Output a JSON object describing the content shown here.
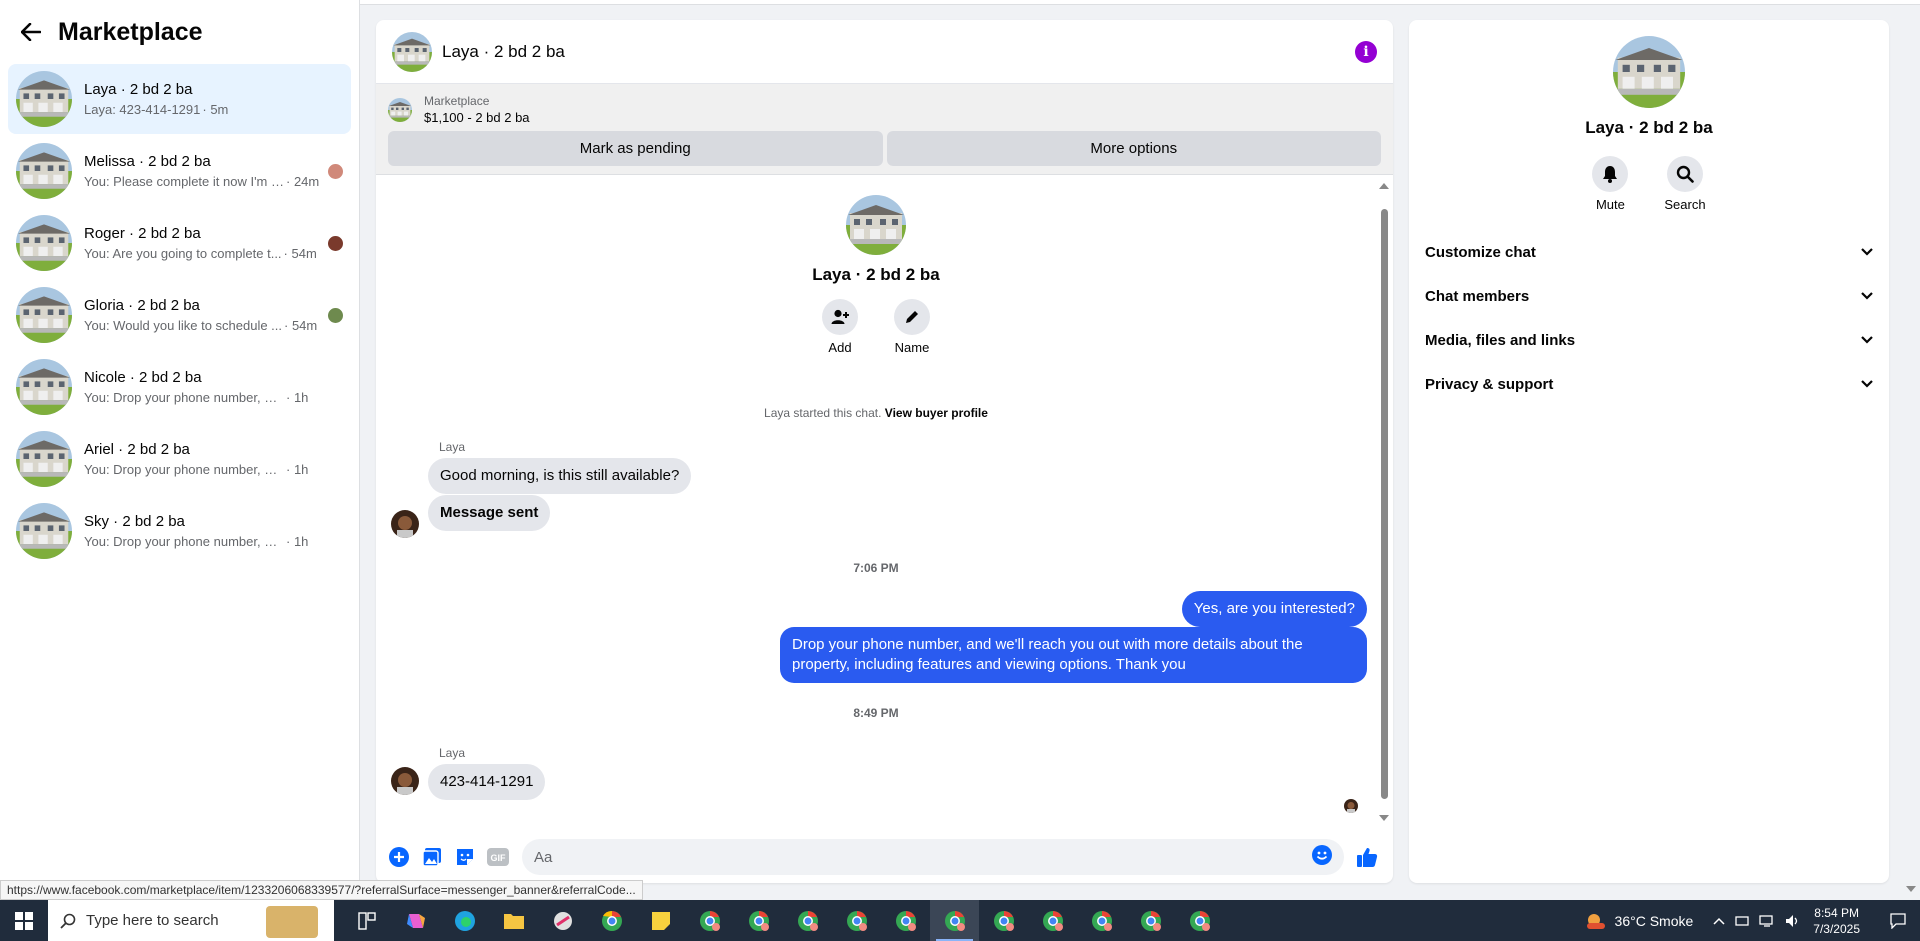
{
  "sidebar": {
    "title": "Marketplace",
    "conversations": [
      {
        "name": "Laya · 2 bd 2 ba",
        "snippet": "Laya: 423-414-1291",
        "time": "· 5m"
      },
      {
        "name": "Melissa · 2 bd 2 ba",
        "snippet": "You: Please complete it now I'm s...",
        "time": "· 24m"
      },
      {
        "name": "Roger · 2 bd 2 ba",
        "snippet": "You: Are you going to complete t...",
        "time": "· 54m"
      },
      {
        "name": "Gloria · 2 bd 2 ba",
        "snippet": "You: Would you like to schedule ...",
        "time": "· 54m"
      },
      {
        "name": "Nicole · 2 bd 2 ba",
        "snippet": "You: Drop your phone number, and w...",
        "time": "· 1h"
      },
      {
        "name": "Ariel · 2 bd 2 ba",
        "snippet": "You: Drop your phone number, and w...",
        "time": "· 1h"
      },
      {
        "name": "Sky · 2 bd 2 ba",
        "snippet": "You: Drop your phone number, and w...",
        "time": "· 1h"
      }
    ]
  },
  "chat": {
    "header_name": "Laya · 2 bd 2 ba",
    "info_icon": "i",
    "banner": {
      "label": "Marketplace",
      "price": "$1,100 - 2 bd 2 ba",
      "mark_pending": "Mark as pending",
      "more_options": "More options"
    },
    "intro": {
      "name": "Laya · 2 bd 2 ba",
      "add_label": "Add",
      "name_label": "Name",
      "started_text": "Laya started this chat.",
      "view_profile": "View buyer profile"
    },
    "messages": {
      "sender1": "Laya",
      "in1": "Good morning, is this still available?",
      "in2": "Message sent",
      "time1": "7:06 PM",
      "out1": "Yes, are you interested?",
      "out2_line1": "Drop your phone number, and we'll reach you out with more details about the",
      "out2_line2": "property, including features and viewing options.  Thank you",
      "time2": "8:49 PM",
      "sender2": "Laya",
      "in3": "423-414-1291"
    },
    "composer_placeholder": "Aa",
    "gif_label": "GIF"
  },
  "right_panel": {
    "name": "Laya · 2 bd 2 ba",
    "mute_label": "Mute",
    "search_label": "Search",
    "sections": [
      "Customize chat",
      "Chat members",
      "Media, files and links",
      "Privacy & support"
    ]
  },
  "status_url": "https://www.facebook.com/marketplace/item/1233206068339577/?referralSurface=messenger_banner&referralCode...",
  "taskbar": {
    "search_placeholder": "Type here to search",
    "weather": "36°C  Smoke",
    "time": "8:54 PM",
    "date": "7/3/2025"
  },
  "colors": {
    "accent": "#2a5bf0",
    "active_conv": "#e7f3ff",
    "info": "#9400d3"
  }
}
